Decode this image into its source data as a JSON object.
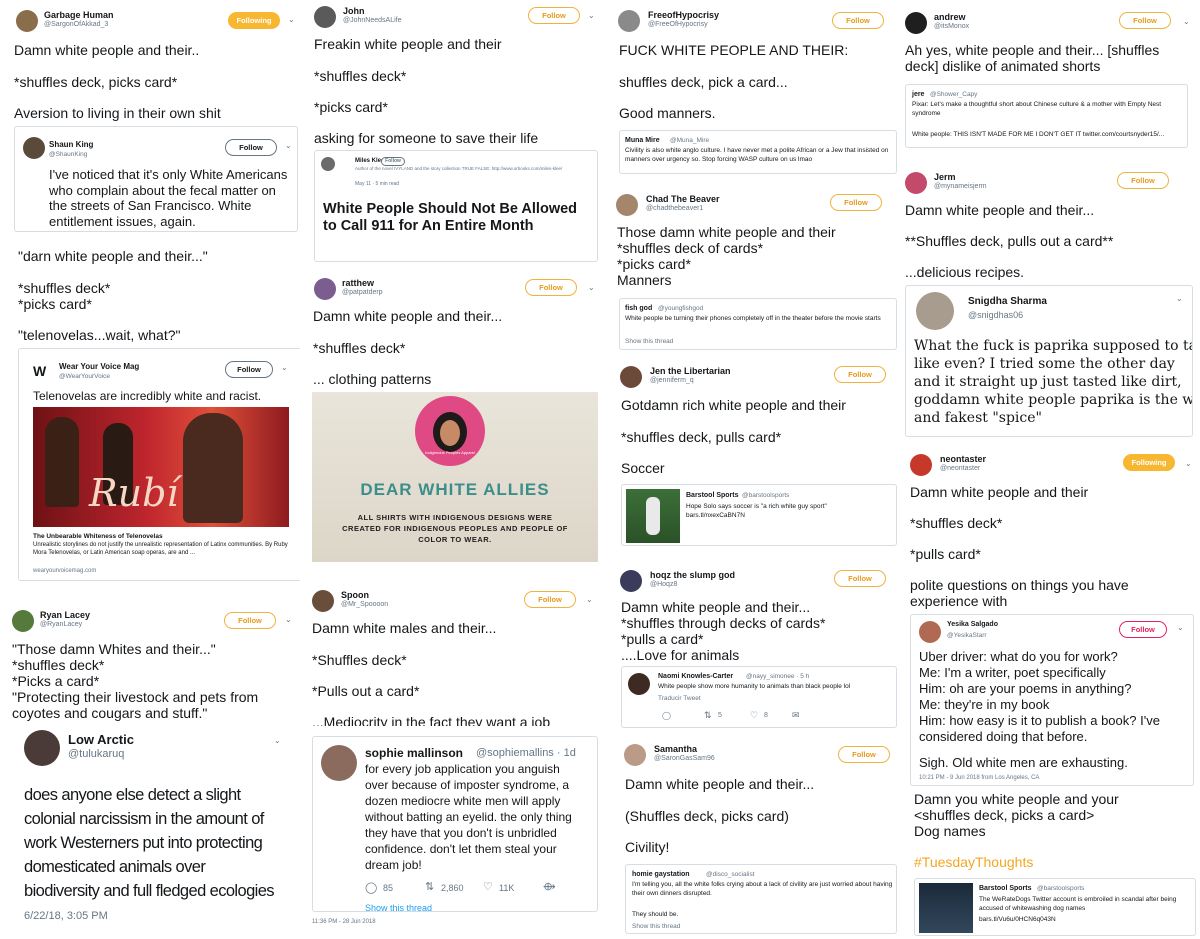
{
  "c1": {
    "t1": {
      "name": "Garbage Human",
      "handle": "@SargonOfAkkad_3",
      "follow": "Following",
      "lines": [
        "Damn white people and their..",
        "*shuffles deck, picks card*",
        "Aversion to living in their own shit"
      ]
    },
    "q1": {
      "name": "Shaun King",
      "handle": "@ShaunKing",
      "follow": "Follow",
      "text": "I've noticed that it's only White Americans who complain about the fecal matter on the streets of San Francisco. White entitlement issues, again."
    },
    "t2": {
      "lines": [
        "\"darn white people and their...\"",
        "*shuffles deck*",
        "*picks card*",
        "\"telenovelas...wait, what?\""
      ]
    },
    "q2": {
      "name": "Wear Your Voice Mag",
      "handle": "@WearYourVoice",
      "follow": "Follow",
      "text": "Telenovelas are incredibly white and racist.",
      "image_word": "Rubí",
      "card_title": "The Unbearable Whiteness of Telenovelas",
      "card_desc": "Unrealistic storylines do not justify the unrealistic representation of Latinx communities. By Ruby Mora Telenovelas, or Latin American soap operas, are and ...",
      "card_url": "wearyourvoicemag.com"
    },
    "t3": {
      "name": "Ryan Lacey",
      "handle": "@RyanLacey",
      "follow": "Follow",
      "lines": [
        "\"Those damn Whites and their...\"",
        "*shuffles deck*",
        "*Picks a card*",
        "\"Protecting their livestock and pets from",
        "coyotes and cougars and stuff.\""
      ]
    },
    "q3": {
      "name": "Low Arctic",
      "handle": "@tulukaruq",
      "lines": [
        "does anyone else detect a slight",
        "colonial narcissism in the amount of",
        "work Westerners put into protecting",
        "domesticated animals over",
        "biodiversity and full fledged ecologies"
      ],
      "time": "6/22/18, 3:05 PM"
    }
  },
  "c2": {
    "t1": {
      "name": "John",
      "handle": "@JohnNeedsALife",
      "follow": "Follow",
      "lines": [
        "Freakin white people and their",
        "*shuffles deck*",
        "*picks card*",
        "asking for someone to save their life"
      ]
    },
    "q1": {
      "name": "Miles Klee",
      "meta": "Author of the novel IVYLAND and the story collection TRUE FALSE: http://www.orbooks.com/miles-klee/",
      "date": "May 11 · 5 min read",
      "follow": "Follow",
      "headline": "White People Should Not Be Allowed to Call 911 for An Entire Month"
    },
    "t2": {
      "name": "ratthew",
      "handle": "@patpatderp",
      "follow": "Follow",
      "lines": [
        "Damn white people and their...",
        "*shuffles deck*",
        "... clothing patterns"
      ]
    },
    "img": {
      "badge": "Indigenous Peoples Apparel",
      "title": "DEAR WHITE ALLIES",
      "sub": "ALL SHIRTS WITH INDIGENOUS DESIGNS WERE CREATED FOR INDIGENOUS PEOPLES AND PEOPLE OF COLOR TO WEAR."
    },
    "t3": {
      "name": "Spoon",
      "handle": "@Mr_Spoooon",
      "follow": "Follow",
      "lines": [
        "Damn white males and their...",
        "*Shuffles deck*",
        "*Pulls out a card*",
        "...Mediocrity in the fact they want a job"
      ]
    },
    "q3": {
      "name": "sophie mallinson",
      "handle": "@sophiemallins · 1d",
      "lines": [
        "for every job application you anguish",
        "over because of imposter syndrome, a",
        "dozen mediocre white men will apply",
        "without batting an eyelid. the only thing",
        "they have that you don't is unbridled",
        "confidence. don't let them steal your",
        "dream job!"
      ],
      "replies": "85",
      "retweets": "2,860",
      "likes": "11K",
      "show": "Show this thread",
      "time": "11:36 PM - 28 Jun 2018"
    }
  },
  "c3": {
    "t1": {
      "name": "FreeofHypocrisy",
      "handle": "@FreeOfHypocrisy",
      "follow": "Follow",
      "lines": [
        "FUCK WHITE PEOPLE AND THEIR:",
        "shuffles deck, pick a card...",
        "Good manners."
      ]
    },
    "q1": {
      "name": "Muna Mire",
      "handle": "@Muna_Mire",
      "text": "Civility is also white anglo culture. I have never met a polite African or a Jew that insisted on manners over urgency so. Stop forcing WASP culture on us lmao"
    },
    "t2": {
      "name": "Chad The Beaver",
      "handle": "@chadthebeaver1",
      "follow": "Follow",
      "lines": [
        "Those damn white people and their",
        "*shuffles deck of cards*",
        "*picks card*",
        "Manners"
      ]
    },
    "q2": {
      "name": "fish god",
      "handle": "@youngfishgod",
      "text": "White people be turning their phones  completely off in the theater before the movie starts",
      "show": "Show this thread"
    },
    "t3": {
      "name": "Jen the Libertarian",
      "handle": "@jenniferm_q",
      "follow": "Follow",
      "lines": [
        "Gotdamn rich white people and their",
        "*shuffles deck, pulls card*",
        "Soccer"
      ]
    },
    "q3": {
      "name": "Barstool Sports",
      "handle": "@barstoolsports",
      "text": "Hope Solo says soccer is \"a rich white guy sport\"",
      "link": "bars.tl/nxexCaBN7N"
    },
    "t4": {
      "name": "hoqz the slump god",
      "handle": "@Hoqz8",
      "follow": "Follow",
      "lines": [
        "Damn white people and their...",
        "*shuffles through decks of cards*",
        "*pulls a card*",
        "....Love for animals"
      ]
    },
    "q4": {
      "name": "Naomi Knowles-Carter",
      "handle": "@nayy_simonee · 5 h",
      "text": "White people show more humanity to animals than black people lol",
      "translate": "Traducir Tweet",
      "retweets": "5",
      "likes": "8"
    },
    "t5": {
      "name": "Samantha",
      "handle": "@SaronGasSam96",
      "follow": "Follow",
      "lines": [
        "Damn white people and their...",
        "(Shuffles deck, picks card)",
        "Civility!"
      ]
    },
    "q5": {
      "name": "homie gaystation",
      "handle": "@disco_socialist",
      "text": "I'm telling you, all the white folks crying about a lack of civility are just worried about having their own dinners disrupted.",
      "text2": "They should be.",
      "show": "Show this thread"
    }
  },
  "c4": {
    "t1": {
      "name": "andrew",
      "handle": "@itsMonox",
      "follow": "Follow",
      "lines": [
        "Ah yes, white people and their... [shuffles",
        "deck] dislike of animated shorts"
      ]
    },
    "q1": {
      "name": "jere",
      "handle": "@Shower_Capy",
      "text": "Pixar: Let's make a thoughtful short about Chinese culture & a mother with Empty Nest syndrome",
      "text2": "White people: THIS ISN'T MADE FOR ME I DON'T GET IT twitter.com/courtsnyder15/..."
    },
    "t2": {
      "name": "Jerm",
      "handle": "@mynameisjerm",
      "follow": "Follow",
      "lines": [
        "Damn white people and their...",
        "**Shuffles deck, pulls out a card**",
        "...delicious recipes."
      ]
    },
    "q2": {
      "name": "Snigdha Sharma",
      "handle": "@snigdhas06",
      "lines": [
        "What the fuck is paprika supposed to taste",
        "like even? I tried some the other day",
        "and it straight up just tasted like dirt,",
        "goddamn white people paprika is the worst",
        "and fakest \"spice\""
      ]
    },
    "t3": {
      "name": "neontaster",
      "handle": "@neontaster",
      "follow": "Following",
      "lines": [
        "Damn white people and their",
        "*shuffles deck*",
        "*pulls card*",
        "polite questions on things you have",
        "experience with"
      ]
    },
    "q3": {
      "name": "Yesika Salgado",
      "handle": "@YesikaStarr",
      "follow": "Follow",
      "lines": [
        "Uber driver: what do you for work?",
        "Me: I'm a writer, poet specifically",
        "Him: oh are your poems in anything?",
        "Me: they're in my book",
        "Him: how easy is it to publish a book? I've",
        "considered doing that before.",
        "",
        "Sigh. Old white men are exhausting."
      ],
      "time": "10:21 PM - 9 Jun 2018 from Los Angeles, CA"
    },
    "t4": {
      "lines": [
        "Damn you white people and your",
        "<shuffles deck, picks a card>",
        "Dog names"
      ],
      "hashtag": "#TuesdayThoughts"
    },
    "q4": {
      "name": "Barstool Sports",
      "handle": "@barstoolsports",
      "text": "The WeRateDogs Twitter account is embroiled in scandal after being accused of whitewashing dog names",
      "link": "bars.tl/Vu6u/0HCN6q043N"
    }
  }
}
